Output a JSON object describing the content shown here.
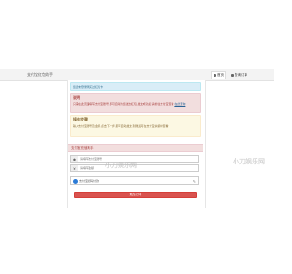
{
  "header": {
    "brand": "支付宝红包助手",
    "nav": [
      {
        "label": "首页",
        "active": true
      },
      {
        "label": "查询订单",
        "active": false
      }
    ]
  },
  "alerts": {
    "info": "您还未登录购买过红包卡",
    "danger_title": "说明",
    "danger_text": "只需在此页面填写支付宝账号,即可自动为您发放红包,发放成功后,请前往支付宝查看",
    "danger_link": "在此查询",
    "warning_title": "操作步骤",
    "warning_text": "输入支付宝账号及金额,点击下一步,即可自动发放,到账后可在支付宝余额中查看"
  },
  "form": {
    "heading": "支付宝充值助手",
    "account_placeholder": "请填写支付宝账号",
    "amount_placeholder": "请填写金额",
    "payment_label": "支付宝扫码付款",
    "submit_label": "提交订单"
  },
  "watermarks": [
    "小刀娱乐网",
    "小刀娱乐网"
  ],
  "colors": {
    "accent": "#d9534f",
    "info_bg": "#d9edf7",
    "danger_bg": "#f2dede",
    "warning_bg": "#fcf8e3",
    "radio": "#2b7bd6"
  },
  "icons": {
    "user": "user-icon",
    "money": "money-icon",
    "payment": "radio-icon",
    "edit": "edit-icon"
  }
}
